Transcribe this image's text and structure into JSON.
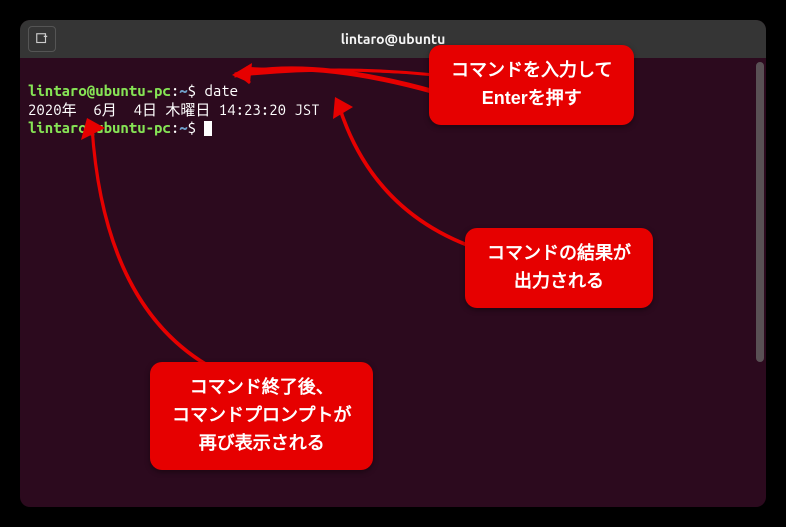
{
  "window": {
    "title": "lintaro@ubuntu"
  },
  "term": {
    "user": "lintaro@ubuntu-pc",
    "path": "~",
    "sep": ":",
    "sigil": "$",
    "command": "date",
    "output": "2020年  6月  4日 木曜日 14:23:20 JST"
  },
  "callouts": {
    "c1_l1": "コマンドを入力して",
    "c1_l2": "Enterを押す",
    "c2_l1": "コマンドの結果が",
    "c2_l2": "出力される",
    "c3_l1": "コマンド終了後、",
    "c3_l2": "コマンドプロンプトが",
    "c3_l3": "再び表示される"
  }
}
